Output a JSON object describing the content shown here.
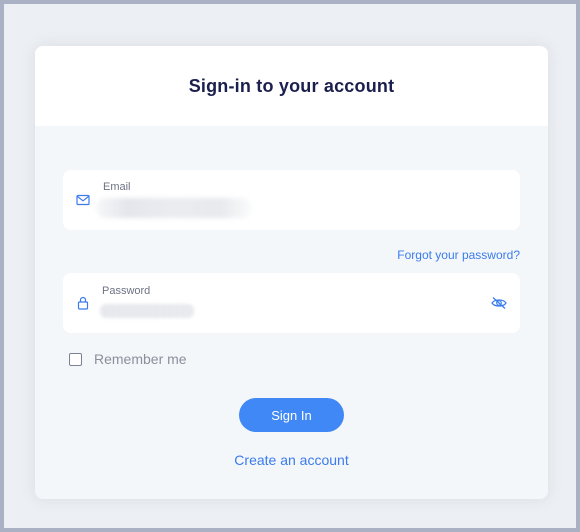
{
  "card": {
    "title": "Sign-in to your account"
  },
  "email_field": {
    "label": "Email",
    "icon": "mail-icon"
  },
  "password_field": {
    "label": "Password",
    "icon": "lock-icon",
    "toggle_icon": "eye-off-icon"
  },
  "forgot_link": "Forgot your password?",
  "remember": {
    "label": "Remember me",
    "checked": false
  },
  "signin_button": "Sign In",
  "create_account_link": "Create an account",
  "colors": {
    "accent": "#4088f5",
    "link": "#3b7bec",
    "title": "#1b1f4d",
    "page_border": "#aab1c4"
  }
}
